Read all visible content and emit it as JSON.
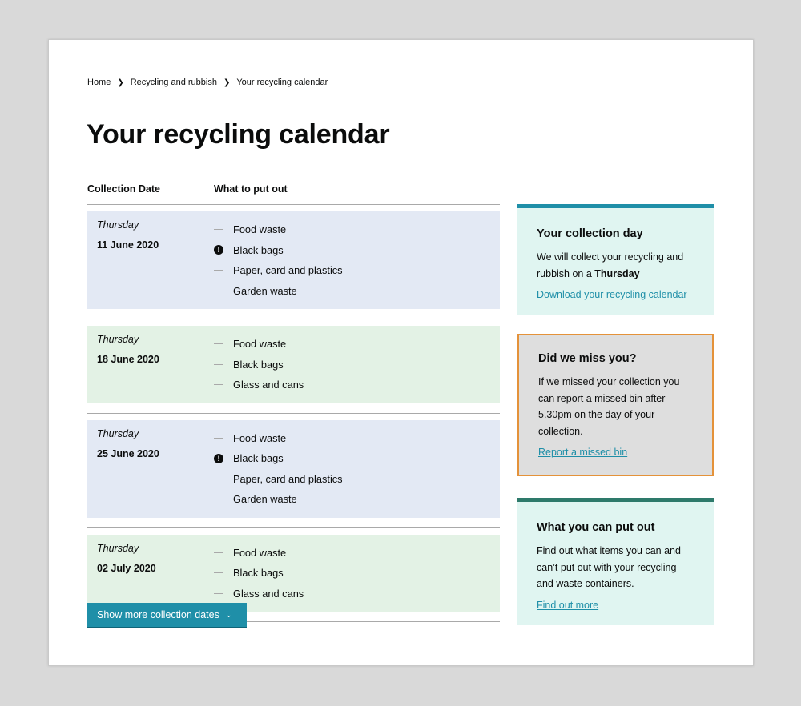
{
  "breadcrumb": {
    "home": "Home",
    "section": "Recycling and rubbish",
    "current": "Your recycling calendar",
    "separator": "❯"
  },
  "page_title": "Your recycling calendar",
  "table": {
    "headers": [
      "Collection Date",
      "What to put out"
    ],
    "rows": [
      {
        "day": "Thursday",
        "date": "11 June 2020",
        "color": "#e3e9f4",
        "items": [
          {
            "label": "Food waste",
            "alert": false
          },
          {
            "label": "Black bags",
            "alert": true
          },
          {
            "label": "Paper, card and plastics",
            "alert": false
          },
          {
            "label": "Garden waste",
            "alert": false
          }
        ]
      },
      {
        "day": "Thursday",
        "date": "18 June 2020",
        "color": "#e3f2e5",
        "items": [
          {
            "label": "Food waste",
            "alert": false
          },
          {
            "label": "Black bags",
            "alert": false
          },
          {
            "label": "Glass and cans",
            "alert": false
          }
        ]
      },
      {
        "day": "Thursday",
        "date": "25 June 2020",
        "color": "#e3e9f4",
        "items": [
          {
            "label": "Food waste",
            "alert": false
          },
          {
            "label": "Black bags",
            "alert": true
          },
          {
            "label": "Paper, card and plastics",
            "alert": false
          },
          {
            "label": "Garden waste",
            "alert": false
          }
        ]
      },
      {
        "day": "Thursday",
        "date": "02 July 2020",
        "color": "#e3f2e5",
        "items": [
          {
            "label": "Food waste",
            "alert": false
          },
          {
            "label": "Black bags",
            "alert": false
          },
          {
            "label": "Glass and cans",
            "alert": false
          }
        ]
      }
    ]
  },
  "show_more_label": "Show more collection dates",
  "cards": {
    "collection_day": {
      "title": "Your collection day",
      "text_before": "We will collect your recycling and rubbish on a ",
      "text_bold": "Thursday",
      "link": "Download your recycling calendar"
    },
    "missed": {
      "title": "Did we miss you?",
      "text": "If we missed your collection you can report a missed bin after 5.30pm on the day of your collection.",
      "link": "Report a missed bin"
    },
    "what_out": {
      "title": "What you can put out",
      "text": "Find out what items you can and can’t put out with your recycling and waste containers.",
      "link": "Find out more"
    }
  },
  "colors": {
    "accent": "#1f8fa8",
    "missed_border": "#e4923a",
    "teal_border": "#2e7a6b"
  }
}
